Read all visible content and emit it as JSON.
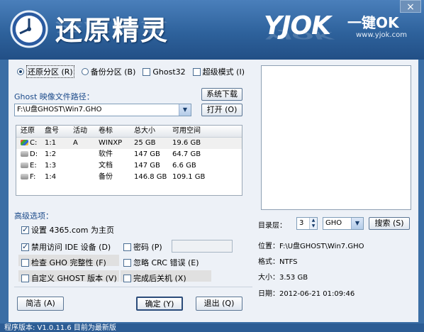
{
  "window": {
    "close_glyph": "×"
  },
  "header": {
    "app_title": "还原精灵",
    "brand": "YJOK",
    "brand_tag": "一键OK",
    "brand_url": "www.yjok.com"
  },
  "mode_options": [
    {
      "label": "还原分区 (R)",
      "type": "radio",
      "checked": true
    },
    {
      "label": "备份分区 (B)",
      "type": "radio",
      "checked": false
    },
    {
      "label": "Ghost32",
      "type": "checkbox",
      "checked": false
    },
    {
      "label": "超级模式 (I)",
      "type": "checkbox",
      "checked": false
    }
  ],
  "image_path": {
    "label": "Ghost 映像文件路径：",
    "value": "F:\\U盘GHOST\\Win7.GHO",
    "download_button": "系统下载",
    "open_button": "打开 (O)"
  },
  "partition_table": {
    "columns": [
      "还原",
      "盘号",
      "活动",
      "卷标",
      "总大小",
      "可用空间"
    ],
    "rows": [
      {
        "drive": "C:",
        "num": "1:1",
        "active": "A",
        "label": "WINXP",
        "total": "25 GB",
        "free": "19.6 GB",
        "icon": "windows-drive-icon",
        "selected": true
      },
      {
        "drive": "D:",
        "num": "1:2",
        "active": "",
        "label": "软件",
        "total": "147 GB",
        "free": "64.7 GB",
        "icon": "drive-icon",
        "selected": false
      },
      {
        "drive": "E:",
        "num": "1:3",
        "active": "",
        "label": "文档",
        "total": "147 GB",
        "free": "6.6 GB",
        "icon": "drive-icon",
        "selected": false
      },
      {
        "drive": "F:",
        "num": "1:4",
        "active": "",
        "label": "备份",
        "total": "146.8 GB",
        "free": "109.1 GB",
        "icon": "drive-icon",
        "selected": false
      }
    ]
  },
  "advanced": {
    "title": "高级选项：",
    "options": [
      {
        "label": "设置 4365.com 为主页",
        "checked": true
      },
      {
        "label": "禁用访问 IDE 设备 (D)",
        "checked": true
      },
      {
        "label": "密码 (P)",
        "checked": false
      },
      {
        "label": "检查 GHO 完整性 (F)",
        "checked": false
      },
      {
        "label": "忽略 CRC 错误 (E)",
        "checked": false
      },
      {
        "label": "自定义 GHOST 版本 (V)",
        "checked": false
      },
      {
        "label": "完成后关机 (X)",
        "checked": false
      }
    ]
  },
  "buttons": {
    "simple": "简洁 (A)",
    "ok": "确定 (Y)",
    "exit": "退出 (Q)"
  },
  "dir_level": {
    "label": "目录层：",
    "value": "3",
    "filter": "GHO",
    "search_button": "搜索 (S)"
  },
  "file_info": {
    "location": "位置：F:\\U盘GHOST\\Win7.GHO",
    "format": "格式：NTFS",
    "size": "大小：3.53 GB",
    "date": "日期：2012-06-21  01:09:46"
  },
  "status": {
    "text": "程序版本: V1.0.11.6  目前为最新版"
  }
}
